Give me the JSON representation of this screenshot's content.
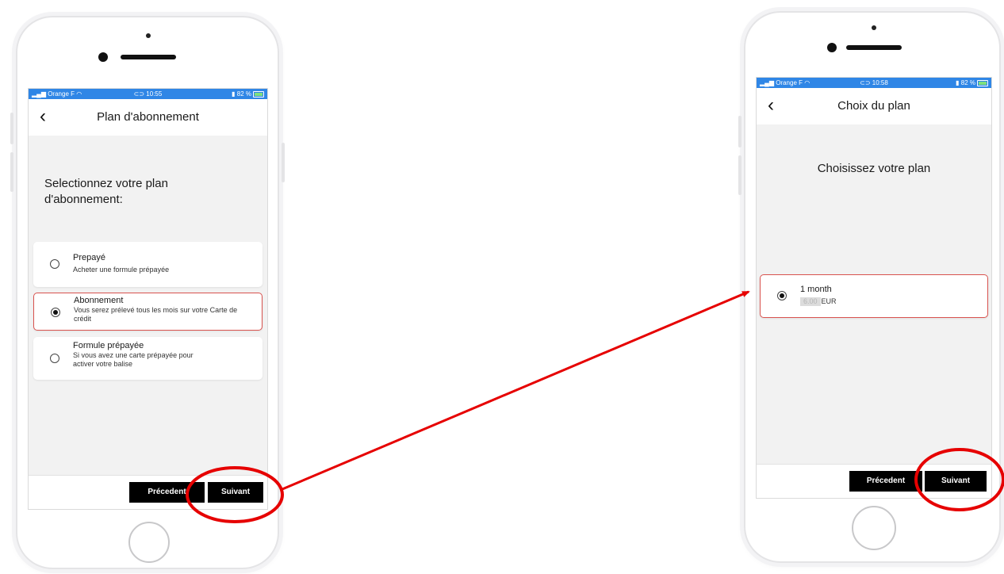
{
  "colors": {
    "statusbar": "#2f86e6",
    "annotation": "#e60000",
    "selected_border": "#d9534f",
    "button_bg": "#000000"
  },
  "left_phone": {
    "status": {
      "carrier": "Orange F",
      "time": "10:55",
      "battery": "82 %"
    },
    "nav": {
      "back_icon": "chevron-left-icon",
      "title": "Plan d'abonnement"
    },
    "heading": "Selectionnez votre plan d'abonnement:",
    "options": [
      {
        "title": "Prepayé",
        "description": "Acheter une formule prépayée",
        "selected": false
      },
      {
        "title": "Abonnement",
        "description": "Vous serez prélevé tous les mois sur votre Carte de crédit",
        "selected": true
      },
      {
        "title": "Formule prépayée",
        "description": "Si vous avez une carte prépayée pour activer votre balise",
        "selected": false
      }
    ],
    "buttons": {
      "previous": "Précedent",
      "next": "Suivant"
    }
  },
  "right_phone": {
    "status": {
      "carrier": "Orange F",
      "time": "10:58",
      "battery": "82 %"
    },
    "nav": {
      "back_icon": "chevron-left-icon",
      "title": "Choix du plan"
    },
    "heading": "Choisissez votre plan",
    "plan": {
      "title": "1 month",
      "price": "6.00",
      "currency": "EUR",
      "selected": true
    },
    "buttons": {
      "previous": "Précedent",
      "next": "Suivant"
    }
  }
}
